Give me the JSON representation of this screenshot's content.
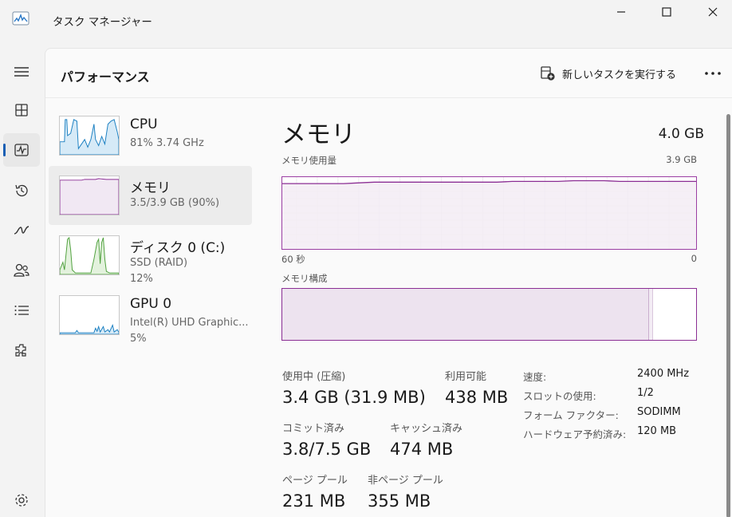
{
  "window": {
    "title": "タスク マネージャー",
    "minimize_icon": "minimize-icon",
    "maximize_icon": "maximize-icon",
    "close_icon": "close-icon"
  },
  "nav": {
    "items": [
      {
        "icon": "hamburger-menu-icon"
      },
      {
        "icon": "processes-icon"
      },
      {
        "icon": "performance-icon",
        "active": true
      },
      {
        "icon": "app-history-icon"
      },
      {
        "icon": "startup-apps-icon"
      },
      {
        "icon": "users-icon"
      },
      {
        "icon": "details-icon"
      },
      {
        "icon": "services-icon"
      },
      {
        "icon": "settings-icon"
      }
    ]
  },
  "header": {
    "title": "パフォーマンス",
    "run_task_label": "新しいタスクを実行する",
    "more_icon": "more-icon"
  },
  "devices": [
    {
      "name": "CPU",
      "sub1": "81%  3.74 GHz",
      "sub2": ""
    },
    {
      "name": "メモリ",
      "sub1": "3.5/3.9 GB (90%)",
      "sub2": "",
      "selected": true
    },
    {
      "name": "ディスク 0 (C:)",
      "sub1": "SSD (RAID)",
      "sub2": "12%"
    },
    {
      "name": "GPU 0",
      "sub1": "Intel(R) UHD Graphic...",
      "sub2": "5%"
    }
  ],
  "detail": {
    "title": "メモリ",
    "total": "4.0 GB",
    "usage_label": "メモリ使用量",
    "usage_max": "3.9 GB",
    "time_left": "60 秒",
    "time_right": "0",
    "composition_label": "メモリ構成",
    "composition": {
      "in_use_fraction": 0.887,
      "modified_fraction": 0.009
    },
    "usage_history_fraction": [
      0.91,
      0.91,
      0.91,
      0.91,
      0.91,
      0.92,
      0.93,
      0.93,
      0.93,
      0.93,
      0.93,
      0.93,
      0.93,
      0.93,
      0.93,
      0.94,
      0.94,
      0.94,
      0.94,
      0.95,
      0.95,
      0.95,
      0.94,
      0.94,
      0.94,
      0.94,
      0.94,
      0.94
    ],
    "stats": {
      "in_use_label": "使用中 (圧縮)",
      "in_use_value": "3.4 GB (31.9 MB)",
      "available_label": "利用可能",
      "available_value": "438 MB",
      "committed_label": "コミット済み",
      "committed_value": "3.8/7.5 GB",
      "cached_label": "キャッシュ済み",
      "cached_value": "474 MB",
      "paged_label": "ページ プール",
      "paged_value": "231 MB",
      "nonpaged_label": "非ページ プール",
      "nonpaged_value": "355 MB"
    },
    "props": {
      "speed_label": "速度:",
      "speed_value": "2400 MHz",
      "slots_label": "スロットの使用:",
      "slots_value": "1/2",
      "form_label": "フォーム ファクター:",
      "form_value": "SODIMM",
      "reserved_label": "ハードウェア予約済み:",
      "reserved_value": "120 MB"
    }
  },
  "colors": {
    "memory": "#8b2e94",
    "cpu": "#1a7fc1",
    "disk": "#4ea03c",
    "accent": "#1a5fb4"
  }
}
